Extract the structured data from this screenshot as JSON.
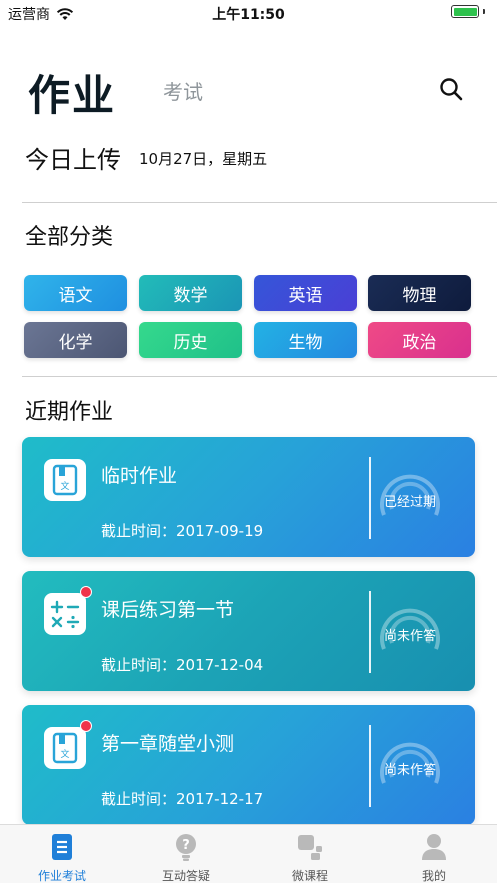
{
  "status_bar": {
    "carrier": "运营商",
    "time": "上午11:50"
  },
  "header": {
    "title": "作业",
    "exam_tab": "考试"
  },
  "today": {
    "label": "今日上传",
    "date": "10月27日，星期五"
  },
  "categories": {
    "title": "全部分类",
    "items": [
      {
        "label": "语文",
        "color": "#29a9e6"
      },
      {
        "label": "数学",
        "color": "#1fb0b0"
      },
      {
        "label": "英语",
        "color": "#3d4fd6"
      },
      {
        "label": "物理",
        "color": "#13244a"
      },
      {
        "label": "化学",
        "color": "#5c6785"
      },
      {
        "label": "历史",
        "color": "#2bcf8a"
      },
      {
        "label": "生物",
        "color": "#1f9ee0"
      },
      {
        "label": "政治",
        "color": "#e63f8a"
      }
    ]
  },
  "recent": {
    "title": "近期作业",
    "items": [
      {
        "title": "临时作业",
        "deadline": "截止时间：2017-09-19",
        "status": "已经过期",
        "icon": "book-icon",
        "unread": false
      },
      {
        "title": "课后练习第一节",
        "deadline": "截止时间：2017-12-04",
        "status": "尚未作答",
        "icon": "calculator-icon",
        "unread": true
      },
      {
        "title": "第一章随堂小测",
        "deadline": "截止时间：2017-12-17",
        "status": "尚未作答",
        "icon": "book-icon",
        "unread": true
      }
    ]
  },
  "tab_bar": {
    "items": [
      {
        "label": "作业考试",
        "icon": "homework-icon",
        "active": true
      },
      {
        "label": "互动答疑",
        "icon": "lightbulb-icon",
        "active": false
      },
      {
        "label": "微课程",
        "icon": "course-icon",
        "active": false
      },
      {
        "label": "我的",
        "icon": "user-icon",
        "active": false
      }
    ]
  },
  "colors": {
    "accent": "#1f7fd8",
    "card_gradient_start": "#1fb8c8",
    "card_gradient_end": "#2a7fe0"
  }
}
